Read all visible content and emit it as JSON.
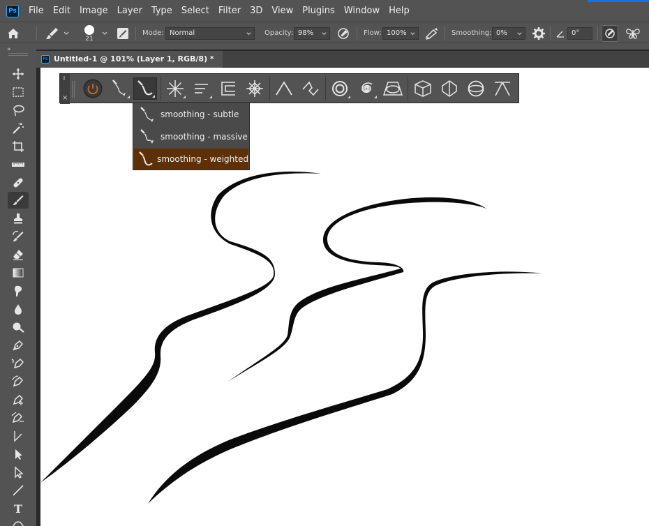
{
  "app": {
    "logo": "Ps",
    "menu": [
      "File",
      "Edit",
      "Image",
      "Layer",
      "Type",
      "Select",
      "Filter",
      "3D",
      "View",
      "Plugins",
      "Window",
      "Help"
    ]
  },
  "options_bar": {
    "brush_size": "21",
    "mode_label": "Mode:",
    "mode_value": "Normal",
    "opacity_label": "Opacity:",
    "opacity_value": "98%",
    "flow_label": "Flow:",
    "flow_value": "100%",
    "smoothing_label": "Smoothing:",
    "smoothing_value": "0%",
    "angle_value": "0°"
  },
  "document": {
    "tab_title": "Untitled-1 @ 101% (Layer 1, RGB/8) *",
    "tab_icon": "Ps"
  },
  "toolbar": {
    "collapse_glyph": "»",
    "text_tool_glyph": "T"
  },
  "panel": {
    "dots_glyph": "⠿",
    "close_glyph": "×"
  },
  "dropdown": {
    "items": [
      {
        "label": "smoothing - subtle",
        "selected": false
      },
      {
        "label": "smoothing - massive",
        "selected": false
      },
      {
        "label": "smoothing - weighted",
        "selected": true
      }
    ]
  },
  "colors": {
    "ui_bg": "#535353",
    "selected_item": "#5d3007",
    "accent_blue": "#1473e6",
    "canvas": "#ffffff"
  }
}
